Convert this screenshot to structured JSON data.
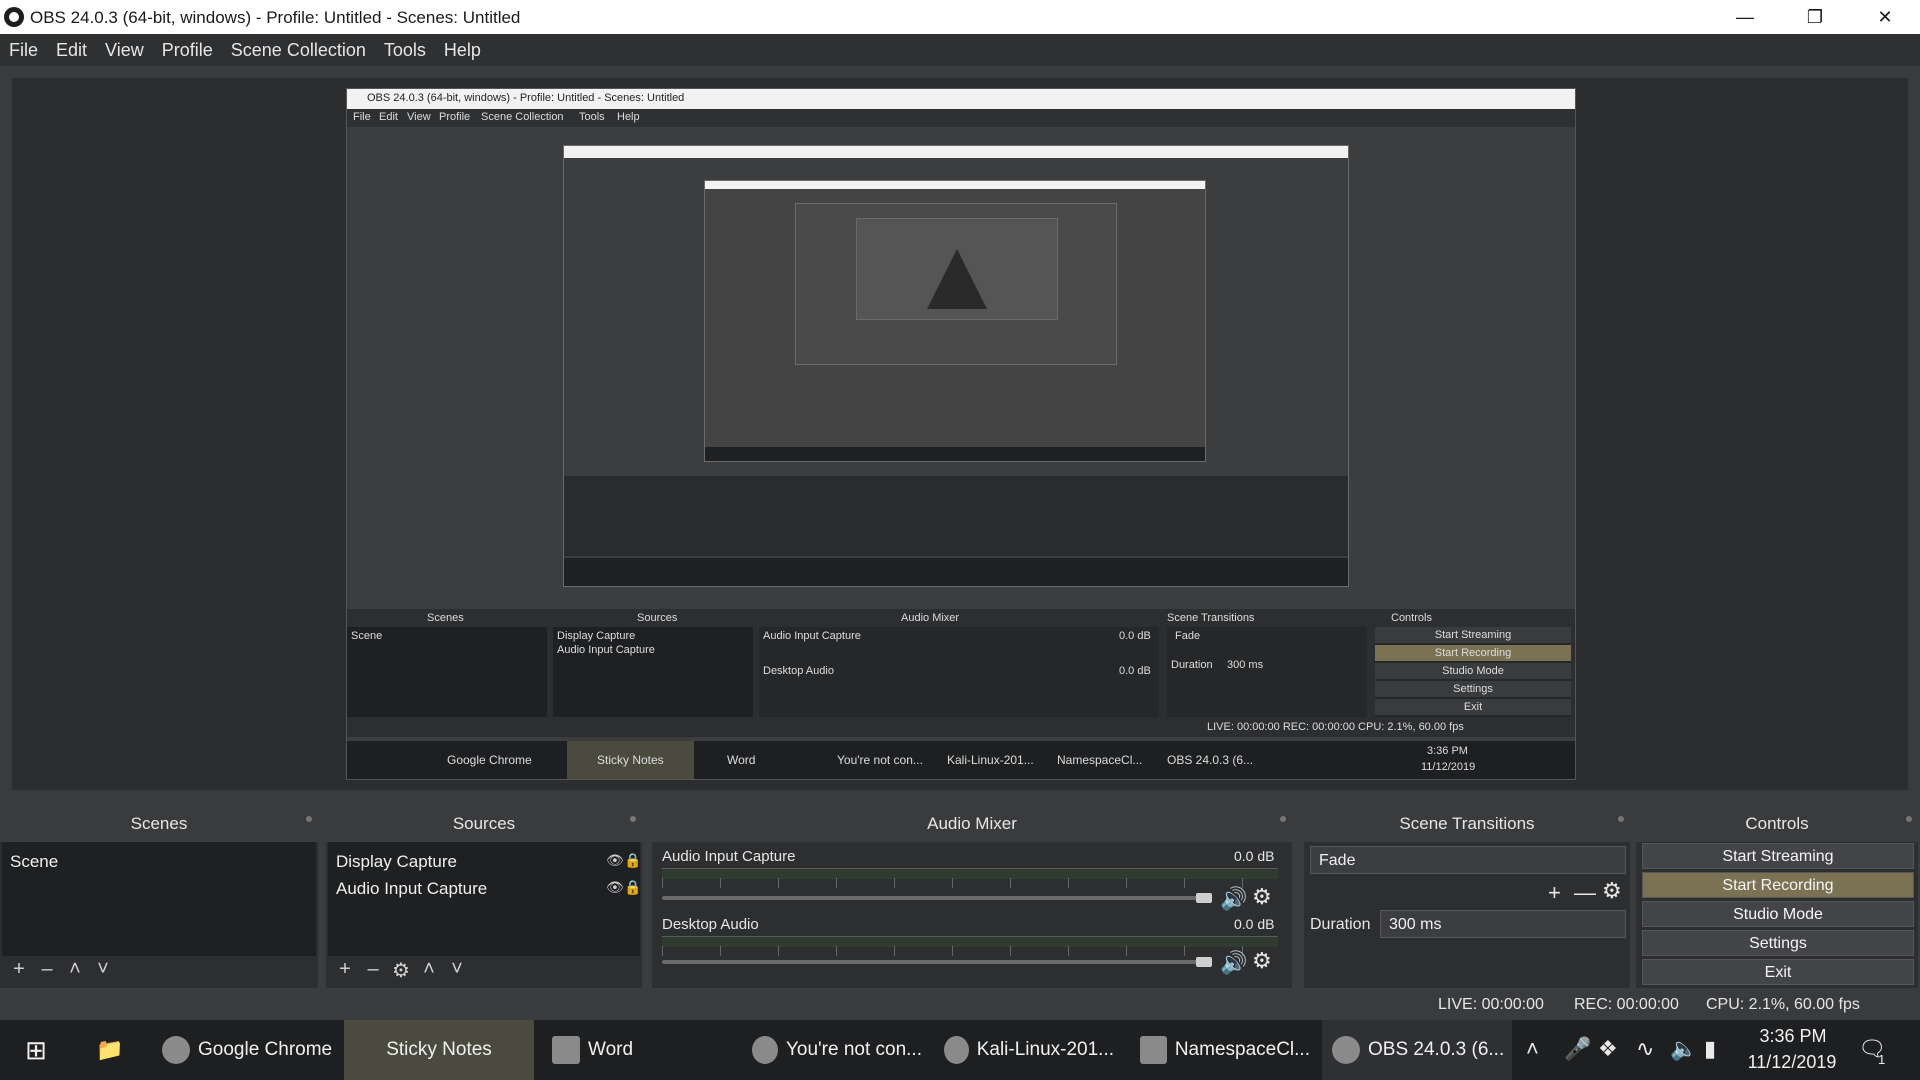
{
  "window": {
    "title": "OBS 24.0.3 (64-bit, windows) - Profile: Untitled - Scenes: Untitled",
    "minimize_icon": "minimize-icon",
    "maximize_icon": "restore-icon",
    "close_icon": "close-icon"
  },
  "menu": [
    "File",
    "Edit",
    "View",
    "Profile",
    "Scene Collection",
    "Tools",
    "Help"
  ],
  "preview": {
    "nested_title": "OBS 24.0.3 (64-bit, windows) - Profile: Untitled - Scenes: Untitled",
    "nested_menu": [
      "File",
      "Edit",
      "View",
      "Profile",
      "Scene Collection",
      "Tools",
      "Help"
    ],
    "nested_docks": [
      "Scenes",
      "Sources",
      "Audio Mixer",
      "Scene Transitions",
      "Controls"
    ],
    "nested_scene": "Scene",
    "nested_sources": [
      "Display Capture",
      "Audio Input Capture"
    ],
    "nested_audio": [
      "Audio Input Capture",
      "Desktop Audio"
    ],
    "nested_db": "0.0 dB",
    "nested_fade": "Fade",
    "nested_duration_label": "Duration",
    "nested_duration": "300 ms",
    "nested_controls": [
      "Start Streaming",
      "Start Recording",
      "Studio Mode",
      "Settings",
      "Exit"
    ],
    "nested_status": "LIVE: 00:00:00    REC: 00:00:00    CPU: 2.1%, 60.00 fps",
    "nested_taskbar": [
      "Google Chrome",
      "Sticky Notes",
      "Word",
      "You're not con...",
      "Kali-Linux-201...",
      "NamespaceCl...",
      "OBS 24.0.3 (6..."
    ],
    "nested_time": "3:36 PM",
    "nested_date": "11/12/2019"
  },
  "docks": {
    "scenes": {
      "title": "Scenes",
      "items": [
        "Scene"
      ]
    },
    "sources": {
      "title": "Sources",
      "items": [
        "Display Capture",
        "Audio Input Capture"
      ]
    },
    "audio_mixer": {
      "title": "Audio Mixer",
      "channels": [
        {
          "name": "Audio Input Capture",
          "db": "0.0 dB"
        },
        {
          "name": "Desktop Audio",
          "db": "0.0 dB"
        }
      ]
    },
    "scene_transitions": {
      "title": "Scene Transitions",
      "transition": "Fade",
      "duration_label": "Duration",
      "duration": "300 ms"
    },
    "controls": {
      "title": "Controls",
      "buttons": [
        "Start Streaming",
        "Start Recording",
        "Studio Mode",
        "Settings",
        "Exit"
      ],
      "active": "Start Recording"
    }
  },
  "status": {
    "live": "LIVE: 00:00:00",
    "rec": "REC: 00:00:00",
    "cpu": "CPU: 2.1%, 60.00 fps"
  },
  "taskbar": {
    "items": [
      "Google Chrome",
      "Sticky Notes",
      "Word",
      "You're not con...",
      "Kali-Linux-201...",
      "NamespaceCl...",
      "OBS 24.0.3 (6..."
    ],
    "time": "3:36 PM",
    "date": "11/12/2019",
    "notification_count": "1"
  },
  "colors": {
    "accent_active": "#7a7253",
    "panel": "#2d2e30",
    "background": "#3a3b3d"
  }
}
